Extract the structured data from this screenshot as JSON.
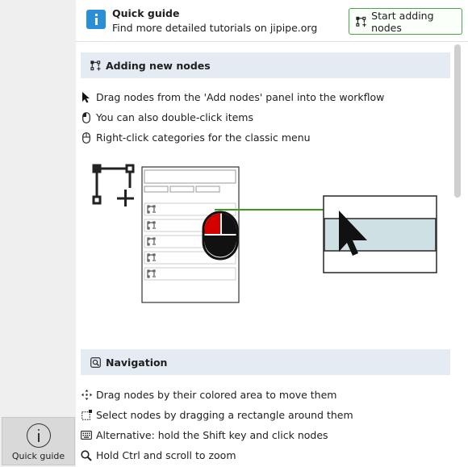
{
  "sidebar": {
    "tab_label": "Quick guide"
  },
  "header": {
    "title": "Quick guide",
    "subtitle": "Find more detailed tutorials on jipipe.org",
    "start_button_label": "Start adding nodes"
  },
  "sections": {
    "adding": {
      "title": "Adding new nodes",
      "items": [
        {
          "icon": "pointer-icon",
          "text": "Drag nodes from the 'Add nodes' panel into the workflow"
        },
        {
          "icon": "mouse-left-icon",
          "text": "You can also double-click items"
        },
        {
          "icon": "mouse-right-icon",
          "text": "Right-click categories for the classic menu"
        }
      ]
    },
    "navigation": {
      "title": "Navigation",
      "items": [
        {
          "icon": "move-icon",
          "text": "Drag nodes by their colored area to move them"
        },
        {
          "icon": "rectangle-select-icon",
          "text": "Select nodes by dragging a rectangle around them"
        },
        {
          "icon": "keyboard-icon",
          "text": "Alternative: hold the Shift key and click nodes"
        },
        {
          "icon": "magnifier-icon",
          "text": "Hold Ctrl and scroll to zoom"
        }
      ]
    }
  },
  "colors": {
    "accent_blue": "#2a8fd6",
    "button_border_green": "#4aa64a",
    "section_bg": "#e4ebf2",
    "arrow_green": "#3a9a1e",
    "mouse_red": "#d40000",
    "target_highlight": "#cfe0e4"
  }
}
